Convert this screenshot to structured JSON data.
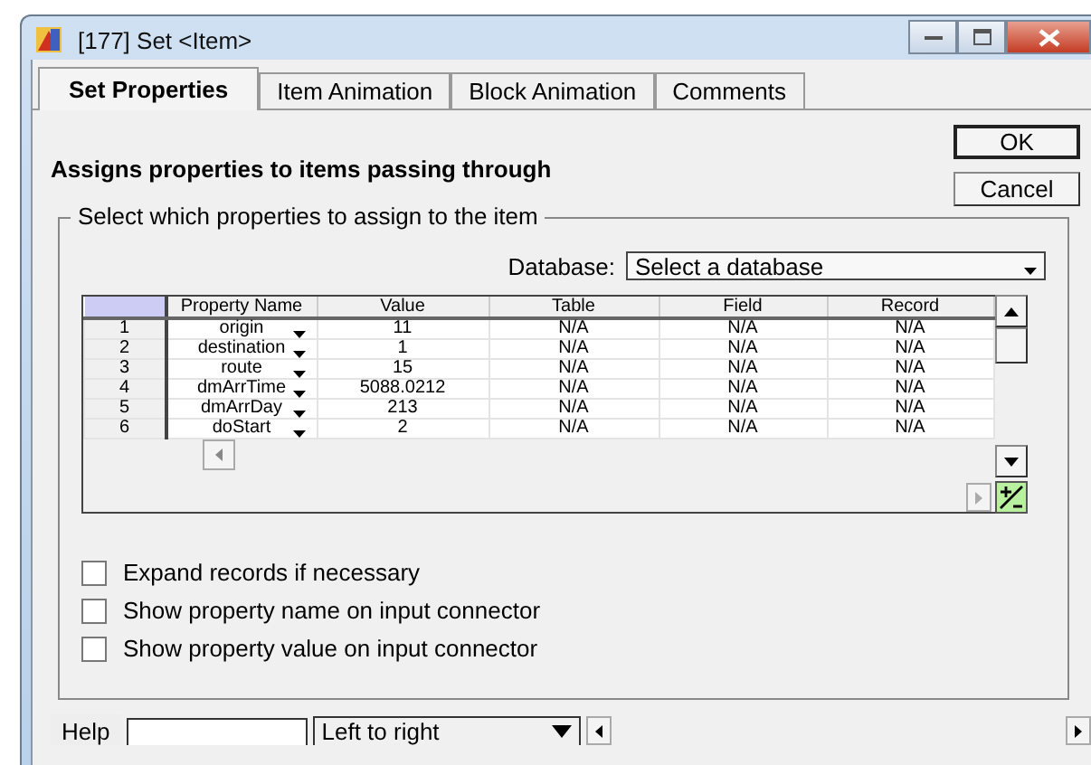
{
  "window": {
    "title": "[177]  Set  <Item>"
  },
  "tabs": [
    {
      "label": "Set Properties",
      "selected": true
    },
    {
      "label": "Item Animation",
      "selected": false
    },
    {
      "label": "Block Animation",
      "selected": false
    },
    {
      "label": "Comments",
      "selected": false
    }
  ],
  "description": "Assigns properties to items passing through",
  "buttons": [
    {
      "label": "OK",
      "default": true
    },
    {
      "label": "Cancel",
      "default": false
    }
  ],
  "group": {
    "title": "Select which properties to assign to the item",
    "database": {
      "label": "Database:",
      "value": "Select a database"
    },
    "table": {
      "columns": [
        "Property Name",
        "Value",
        "Table",
        "Field",
        "Record"
      ],
      "rows": [
        {
          "index": "1",
          "cells": [
            "origin",
            "11",
            "N/A",
            "N/A",
            "N/A"
          ]
        },
        {
          "index": "2",
          "cells": [
            "destination",
            "1",
            "N/A",
            "N/A",
            "N/A"
          ]
        },
        {
          "index": "3",
          "cells": [
            "route",
            "15",
            "N/A",
            "N/A",
            "N/A"
          ]
        },
        {
          "index": "4",
          "cells": [
            "dmArrTime",
            "5088.0212",
            "N/A",
            "N/A",
            "N/A"
          ]
        },
        {
          "index": "5",
          "cells": [
            "dmArrDay",
            "213",
            "N/A",
            "N/A",
            "N/A"
          ]
        },
        {
          "index": "6",
          "cells": [
            "doStart",
            "2",
            "N/A",
            "N/A",
            "N/A"
          ]
        }
      ]
    },
    "checkboxes": [
      {
        "label": "Expand records if necessary",
        "checked": false
      },
      {
        "label": "Show property name on input connector",
        "checked": false
      },
      {
        "label": "Show property value on input connector",
        "checked": false
      }
    ]
  },
  "status_bar": {
    "help": "Help",
    "direction": "Left to right"
  }
}
